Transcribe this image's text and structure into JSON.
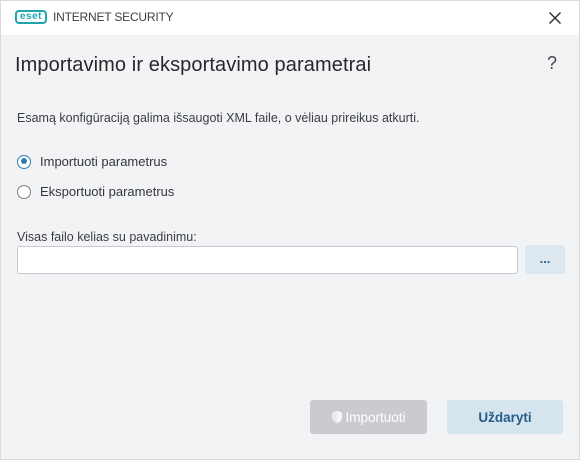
{
  "app": {
    "logo_text": "eset",
    "product_name": "INTERNET SECURITY"
  },
  "dialog": {
    "title": "Importavimo ir eksportavimo parametrai",
    "help_label": "?",
    "description": "Esamą konfigūraciją galima išsaugoti XML faile, o vėliau prireikus atkurti.",
    "options": [
      {
        "label": "Importuoti parametrus",
        "checked": true
      },
      {
        "label": "Eksportuoti parametrus",
        "checked": false
      }
    ],
    "file_path": {
      "label": "Visas failo kelias su pavadinimu:",
      "value": "",
      "browse_label": "..."
    },
    "buttons": {
      "import_label": "Importuoti",
      "import_enabled": false,
      "close_label": "Uždaryti"
    }
  },
  "colors": {
    "accent": "#2a7fb1",
    "logo": "#1ea5b0",
    "primary_button_bg": "#d6e4ee",
    "disabled_button_bg": "#c9cbce",
    "window_bg": "#f2f3f4"
  }
}
